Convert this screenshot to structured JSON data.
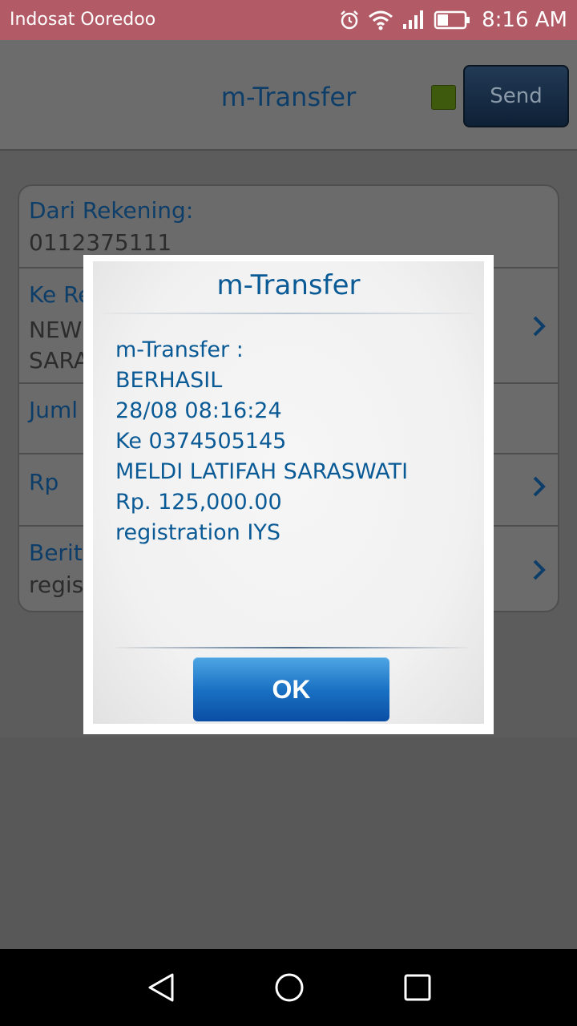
{
  "status_bar": {
    "carrier": "Indosat Ooredoo",
    "time": "8:16 AM",
    "icons": [
      "alarm-icon",
      "wifi-icon",
      "signal-icon",
      "battery-icon"
    ]
  },
  "app": {
    "title": "m-Transfer",
    "send_label": "Send",
    "status_color": "#3e5a0c",
    "form": {
      "from_account": {
        "label": "Dari Rekening:",
        "value": "0112375111"
      },
      "to_account": {
        "label": "Ke Re",
        "value_lines": [
          "NEW",
          "SARA"
        ]
      },
      "amount_type": {
        "label": "Juml"
      },
      "amount": {
        "label": "Rp"
      },
      "message": {
        "label": "Berita",
        "value": "regis"
      }
    }
  },
  "dialog": {
    "title": "m-Transfer",
    "lines": [
      "m-Transfer :",
      "BERHASIL",
      "28/08 08:16:24",
      "Ke 0374505145",
      "MELDI LATIFAH SARASWATI",
      "Rp. 125,000.00",
      "registration IYS"
    ],
    "ok_label": "OK",
    "accent_color": "#0a5a96"
  },
  "nav_bar": {
    "buttons": [
      "back-icon",
      "home-icon",
      "recents-icon"
    ]
  }
}
